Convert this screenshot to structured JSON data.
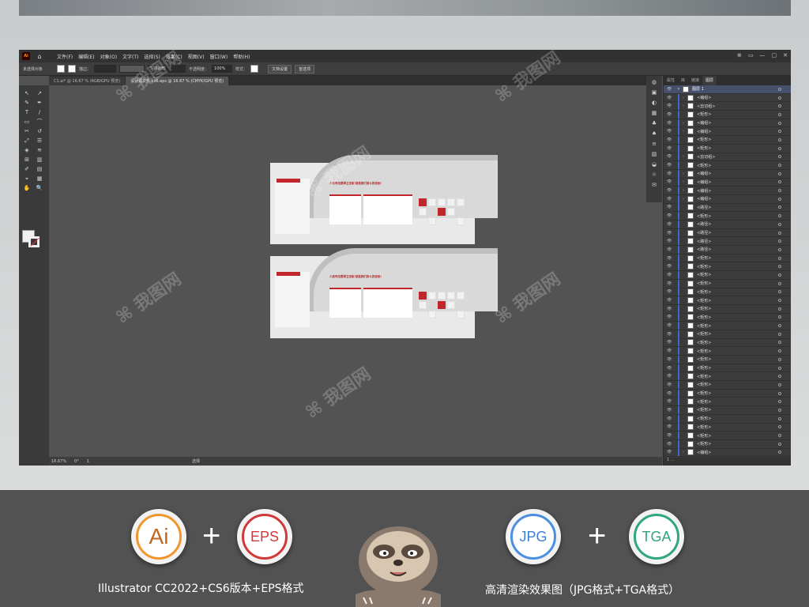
{
  "window": {
    "app_icon": "Ai",
    "menu": [
      "文件(F)",
      "编辑(E)",
      "对象(O)",
      "文字(T)",
      "选择(S)",
      "效果(C)",
      "视图(V)",
      "窗口(W)",
      "帮助(H)"
    ],
    "controls": [
      "⊕",
      "▭",
      "—",
      "▢",
      "✕"
    ]
  },
  "control_bar": {
    "selection_label": "未选择对象",
    "stroke_label": "描边：",
    "stroke_value": "5 点圆形",
    "opacity_label": "不透明度：",
    "opacity_value": "100%",
    "style_label": "样式：",
    "doc_setup": "文档设置",
    "prefs": "首选项"
  },
  "tabs": [
    {
      "label": "C1.ai* @ 16.67 % (RGB/GPU 预览)",
      "active": false
    },
    {
      "label": "设计源文件-cs6.eps @ 16.67 % (CMYK/GPU 预览)",
      "active": true
    }
  ],
  "tools": [
    "↖",
    "↗",
    "✎",
    "✒",
    "T",
    "/",
    "▭",
    "⌒",
    "✂",
    "↺",
    "⤢",
    "☰",
    "◈",
    "≋",
    "⊞",
    "▥",
    "✐",
    "▤",
    "⌖",
    "▦",
    "✋",
    "🔍"
  ],
  "status_bar": {
    "zoom": "16.67%",
    "angle": "0°",
    "artboard": "1",
    "mode": "选择"
  },
  "panel": {
    "tabs": [
      "属性",
      "库",
      "图层",
      "链接"
    ],
    "active_tab": "图层",
    "top_layer": "图层 1",
    "items": [
      "<编组>",
      "<剪切组>",
      "<矩形>",
      "<编组>",
      "<编组>",
      "<矩形>",
      "<矩形>",
      "<剪切组>",
      "<矩形>",
      "<编组>",
      "<编组>",
      "<编组>",
      "<编组>",
      "<路径>",
      "<矩形>",
      "<路径>",
      "<路径>",
      "<路径>",
      "<路径>",
      "<矩形>",
      "<矩形>",
      "<矩形>",
      "<矩形>",
      "<矩形>",
      "<矩形>",
      "<矩形>",
      "<矩形>",
      "<矩形>",
      "<矩形>",
      "<矩形>",
      "<矩形>",
      "<矩形>",
      "<矩形>",
      "<矩形>",
      "<矩形>",
      "<矩形>",
      "<矩形>",
      "<矩形>",
      "<矩形>",
      "<矩形>",
      "<矩形>",
      "<矩形>",
      "<编组>"
    ],
    "footer": "1 ..."
  },
  "artwork": {
    "slogan": "人民司法要捍卫法制  就是我们奋斗的目标！",
    "panel_title": "党建文化宣传"
  },
  "footer": {
    "badges": [
      "Ai",
      "EPS",
      "JPG",
      "TGA"
    ],
    "plus": "+",
    "caption_left": "Illustrator CC2022+CS6版本+EPS格式",
    "caption_right": "高清渲染效果图（JPG格式+TGA格式）"
  },
  "colors": {
    "ai_orange": "#f0962e",
    "eps_red": "#d0383a",
    "jpg_blue": "#4a8fe0",
    "tga_green": "#2fa77a",
    "accent_red": "#c0262c"
  }
}
